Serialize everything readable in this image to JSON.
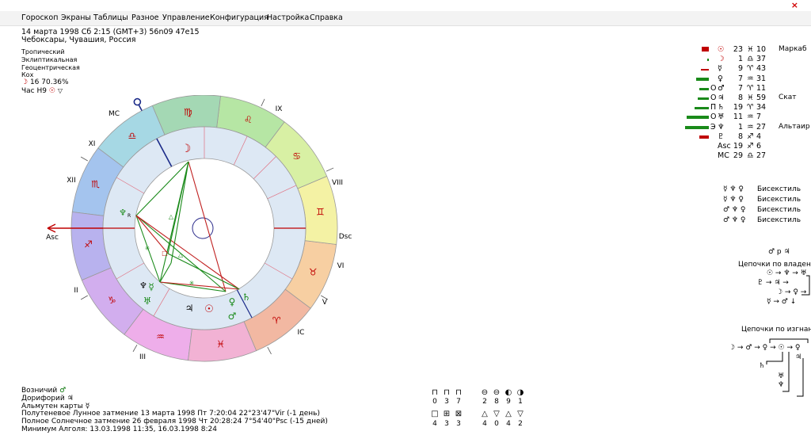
{
  "window": {
    "close_glyph": "×"
  },
  "menu": [
    "Гороскоп",
    "Экраны",
    "Таблицы",
    "Разное",
    "Управление",
    "Конфигурация",
    "Настройка",
    "Справка"
  ],
  "header": {
    "line1": "14 марта 1998  Сб   2:15 (GMT+3)  56n09  47e15",
    "line2": "Чебоксары, Чувашия, Россия"
  },
  "settings": {
    "zodiac": "Тропический",
    "coords": "Эклиптикальная",
    "center": "Геоцентрическая",
    "houses": "Кох",
    "moon_glyph": "☽",
    "moon_value": "16 70.36%",
    "hour": "Час Н9"
  },
  "chart": {
    "house_labels": {
      "mc": "MC",
      "ic": "IC",
      "asc": "Asc",
      "dsc": "Dsc",
      "h2": "II",
      "h3": "III",
      "h5": "V",
      "h6": "VI",
      "h8": "VIII",
      "h9": "IX",
      "h11": "XI",
      "h12": "XII"
    },
    "signs": [
      "♈",
      "♉",
      "♊",
      "♋",
      "♌",
      "♍",
      "♎",
      "♏",
      "♐",
      "♑",
      "♒",
      "♓"
    ],
    "sign_colors": [
      "#f2b8a2",
      "#f7cfa2",
      "#f4f2a4",
      "#d8f0a4",
      "#b6e6a4",
      "#a4d8b4",
      "#a6d8e4",
      "#a4c4ee",
      "#b8b2ee",
      "#d2aeee",
      "#eeaeea",
      "#f2b2d4"
    ],
    "planets": {
      "sun": "☉",
      "moon": "☽",
      "mercury": "☿",
      "venus": "♀",
      "mars": "♂",
      "jupiter": "♃",
      "saturn": "♄",
      "uranus": "♅",
      "neptune": "♆",
      "pluto": "♇",
      "node": "☊",
      "lilith": "⚸"
    },
    "retro_mark": "R"
  },
  "positions": [
    {
      "planet": "☉",
      "status": "",
      "deg": "23",
      "sign": "♓",
      "min": "10",
      "star": "Маркаб"
    },
    {
      "planet": "☽",
      "status": "",
      "deg": "1",
      "sign": "♎",
      "min": "37",
      "star": ""
    },
    {
      "planet": "☿",
      "status": "",
      "deg": "9",
      "sign": "♈",
      "min": "43",
      "star": ""
    },
    {
      "planet": "♀",
      "status": "",
      "deg": "7",
      "sign": "♒",
      "min": "31",
      "star": ""
    },
    {
      "planet": "♂",
      "status": "О",
      "deg": "7",
      "sign": "♈",
      "min": "11",
      "star": ""
    },
    {
      "planet": "♃",
      "status": "О",
      "deg": "8",
      "sign": "♓",
      "min": "59",
      "star": "Скат"
    },
    {
      "planet": "♄",
      "status": "П",
      "deg": "19",
      "sign": "♈",
      "min": "34",
      "star": ""
    },
    {
      "planet": "♅",
      "status": "О",
      "deg": "11",
      "sign": "♒",
      "min": "7",
      "star": ""
    },
    {
      "planet": "♆",
      "status": "Э",
      "deg": "1",
      "sign": "♒",
      "min": "27",
      "star": "Альтаир"
    },
    {
      "planet": "♇",
      "status": "",
      "deg": "8",
      "sign": "♐",
      "min": "4",
      "star": ""
    },
    {
      "planet": "Asc",
      "status": "",
      "deg": "19",
      "sign": "♐",
      "min": "6",
      "star": ""
    },
    {
      "planet": "MC",
      "status": "",
      "deg": "29",
      "sign": "♎",
      "min": "27",
      "star": ""
    }
  ],
  "bissextiles": [
    {
      "glyphs": "☿ ♆ ♀",
      "label": "Бисекстиль"
    },
    {
      "glyphs": "☿ ♆ ♀",
      "label": "Бисекстиль"
    },
    {
      "glyphs": "♂ ♆ ♀",
      "label": "Бисекстиль"
    },
    {
      "glyphs": "♂ ♆ ♀",
      "label": "Бисекстиль"
    }
  ],
  "chains": {
    "reception": "♂ р ♃",
    "ownership_title": "Цепочки по владени",
    "own_line1": "☉ → ♆ → ♅",
    "own_line2": "♇ → ♃ → ",
    "own_line3": "☽ → ♀ →",
    "own_line4": "☿ → ♂ ↓",
    "exile_title": "Цепочки по изгнани",
    "exile_line1": "☽ → ♂ → ♀ → ☉ → ♀",
    "exile_line2": "♃",
    "exile_line3": "♄",
    "exile_line4": "♅",
    "exile_line5": "♆"
  },
  "footer": {
    "ruler_label": "Возничий",
    "ruler_glyph": "♂",
    "dory_label": "Дорифорий",
    "dory_glyph": "♃",
    "almuten_label": "Альмутен карты",
    "almuten_glyph": "☿",
    "eclipse1": "Полутеневое Лунное затмение 13 марта 1998 Пт  7:20:04 22°23'47\"Vir (-1 день)",
    "eclipse2": "Полное Солнечное затмение 26 февраля 1998 Чт 20:28:24  7°54'40\"Psc (-15 дней)",
    "algol": "Минимум Алголя: 13.03.1998 11:35,  16.03.1998  8:24"
  },
  "stats": {
    "row1_glyphs": [
      "⊓",
      "⊓",
      "⊓"
    ],
    "row1_values": [
      "0",
      "3",
      "7"
    ],
    "row1b_glyphs": [
      "⊖",
      "⊖",
      "◐",
      "◑"
    ],
    "row1b_values": [
      "2",
      "8",
      "9",
      "1"
    ],
    "row2_glyphs": [
      "□",
      "⊞",
      "⊠"
    ],
    "row2_values": [
      "4",
      "3",
      "3"
    ],
    "row2b_glyphs": [
      "△",
      "▽",
      "△",
      "▽"
    ],
    "row2b_values": [
      "4",
      "0",
      "4",
      "2"
    ]
  }
}
